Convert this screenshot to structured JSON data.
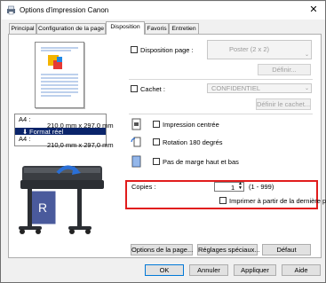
{
  "window": {
    "title": "Options d'impression Canon",
    "close_glyph": "✕"
  },
  "tabs": [
    {
      "label": "Principal"
    },
    {
      "label": "Configuration de la page"
    },
    {
      "label": "Disposition"
    },
    {
      "label": "Favoris"
    },
    {
      "label": "Entretien"
    }
  ],
  "preview": {
    "size_line1_label": "A4 :",
    "size_line1_value": "210,0 mm x 297,0 mm",
    "selected": "Format réel",
    "size_line2_label": "A4 :",
    "size_line2_value": "210,0 mm x 297,0 mm"
  },
  "layout": {
    "disposition_label": "Disposition page :",
    "disposition_value": "Poster (2 x 2)",
    "define_button": "Définir...",
    "stamp_label": "Cachet :",
    "stamp_value": "CONFIDENTIEL",
    "define_stamp_button": "Définir le cachet...",
    "centered_label": "Impression centrée",
    "rotate_label": "Rotation 180 degrés",
    "no_margin_label": "Pas de marge haut et bas"
  },
  "copies": {
    "label": "Copies :",
    "value": "1",
    "range": "(1 - 999)",
    "last_page_label": "Imprimer à partir de la dernière page"
  },
  "panel_buttons": {
    "page_options": "Options de la page...",
    "special_settings": "Réglages spéciaux...",
    "default": "Défaut"
  },
  "dialog_buttons": {
    "ok": "OK",
    "cancel": "Annuler",
    "apply": "Appliquer",
    "help": "Aide"
  },
  "colors": {
    "accent": "#0a246a",
    "highlight_box": "#e11c1c"
  }
}
